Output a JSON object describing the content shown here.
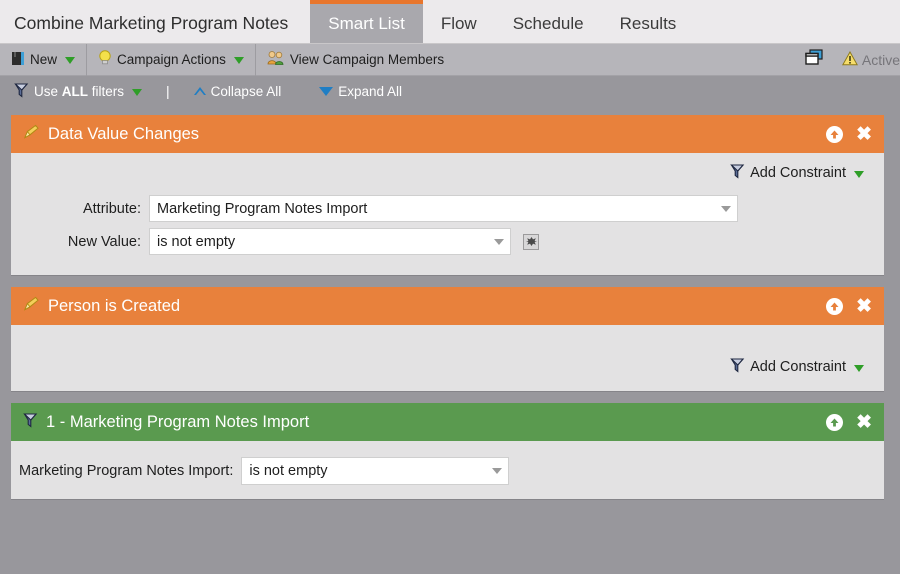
{
  "tabs": {
    "program_title": "Combine Marketing Program Notes",
    "items": [
      {
        "label": "Smart List",
        "active": true
      },
      {
        "label": "Flow",
        "active": false
      },
      {
        "label": "Schedule",
        "active": false
      },
      {
        "label": "Results",
        "active": false
      }
    ]
  },
  "toolbar": {
    "new_label": "New",
    "campaign_actions_label": "Campaign Actions",
    "view_campaign_members_label": "View Campaign Members",
    "status_label": "Active"
  },
  "filterbar": {
    "use_filters_prefix": "Use ",
    "use_filters_bold": "ALL",
    "use_filters_suffix": " filters",
    "separator": "|",
    "collapse_all_label": "Collapse All",
    "expand_all_label": "Expand All"
  },
  "panels": [
    {
      "title": "Data Value Changes",
      "color": "orange",
      "icon": "pencil-icon",
      "add_constraint_label": "Add Constraint",
      "fields": [
        {
          "label": "Attribute:",
          "value": "Marketing Program Notes Import"
        },
        {
          "label": "New Value:",
          "value": "is not empty"
        }
      ]
    },
    {
      "title": "Person is Created",
      "color": "orange",
      "icon": "pencil-icon",
      "add_constraint_label": "Add Constraint",
      "fields": []
    },
    {
      "title": "1 - Marketing Program Notes Import",
      "color": "green",
      "icon": "funnel-icon",
      "inline_label": "Marketing Program Notes Import:",
      "inline_value": "is not empty"
    }
  ],
  "colors": {
    "accent_orange": "#e8813c",
    "accent_green": "#5a9a4f",
    "page_background": "#98979c",
    "panel_background": "#e3e2e3",
    "active_tab": "#a9a8ad"
  }
}
